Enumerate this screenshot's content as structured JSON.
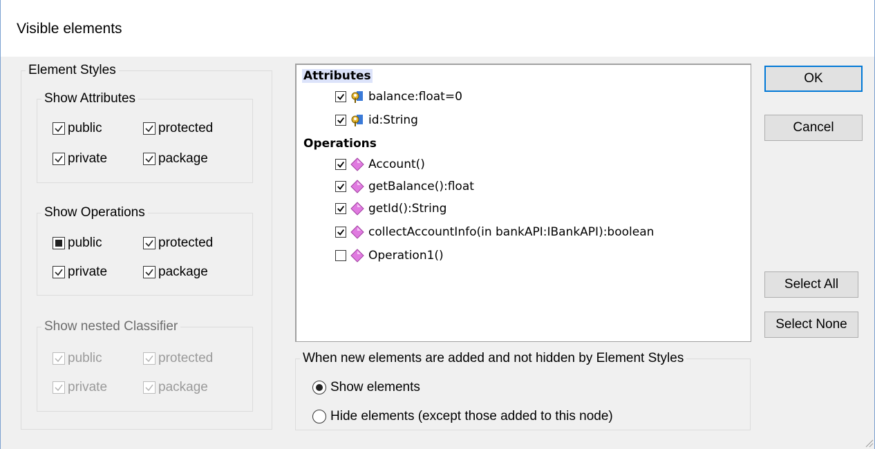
{
  "window": {
    "title": "Visible elements"
  },
  "element_styles": {
    "legend": "Element Styles",
    "attributes": {
      "legend": "Show Attributes",
      "public": {
        "label": "public",
        "state": "checked"
      },
      "protected": {
        "label": "protected",
        "state": "checked"
      },
      "private": {
        "label": "private",
        "state": "checked"
      },
      "package": {
        "label": "package",
        "state": "checked"
      }
    },
    "operations": {
      "legend": "Show Operations",
      "public": {
        "label": "public",
        "state": "indeterminate"
      },
      "protected": {
        "label": "protected",
        "state": "checked"
      },
      "private": {
        "label": "private",
        "state": "checked"
      },
      "package": {
        "label": "package",
        "state": "checked"
      }
    },
    "nested": {
      "legend": "Show nested Classifier",
      "public": {
        "label": "public",
        "state": "checked-disabled"
      },
      "protected": {
        "label": "protected",
        "state": "checked-disabled"
      },
      "private": {
        "label": "private",
        "state": "checked-disabled"
      },
      "package": {
        "label": "package",
        "state": "checked-disabled"
      }
    }
  },
  "tree": {
    "attributes_label": "Attributes",
    "attributes": [
      {
        "label": "balance:float=0",
        "checked": true,
        "icon": "key-attribute-icon"
      },
      {
        "label": "id:String",
        "checked": true,
        "icon": "key-attribute-icon"
      }
    ],
    "operations_label": "Operations",
    "operations": [
      {
        "label": "Account()",
        "checked": true,
        "icon": "operation-diamond-icon"
      },
      {
        "label": "getBalance():float",
        "checked": true,
        "icon": "operation-diamond-icon"
      },
      {
        "label": "getId():String",
        "checked": true,
        "icon": "operation-diamond-icon"
      },
      {
        "label": "collectAccountInfo(in bankAPI:IBankAPI):boolean",
        "checked": true,
        "icon": "operation-diamond-icon"
      },
      {
        "label": "Operation1()",
        "checked": false,
        "icon": "operation-diamond-icon"
      }
    ]
  },
  "new_elements": {
    "legend": "When new elements are added and not hidden by Element Styles",
    "show": {
      "label": "Show elements",
      "selected": true
    },
    "hide": {
      "label": "Hide elements (except those added to this node)",
      "selected": false
    }
  },
  "buttons": {
    "ok": "OK",
    "cancel": "Cancel",
    "select_all": "Select All",
    "select_none": "Select None"
  },
  "colors": {
    "accent": "#0078d7",
    "selection": "#dce3fa",
    "diamond": "#e070e0",
    "key": "#d4a017"
  }
}
